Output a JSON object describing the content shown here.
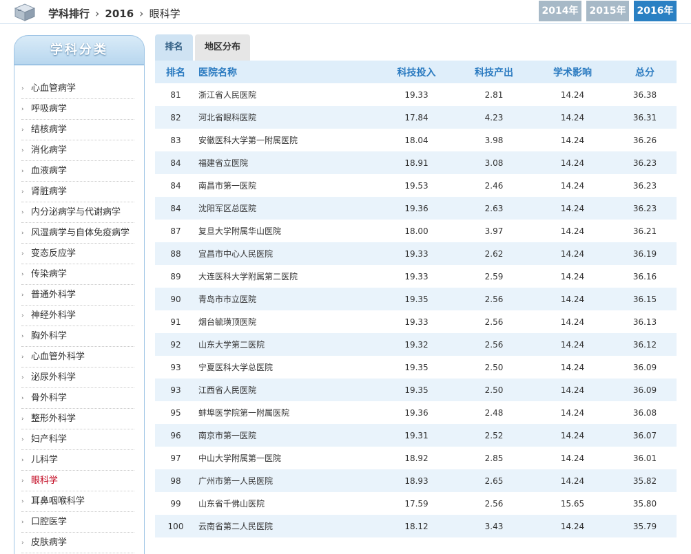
{
  "breadcrumb": {
    "root": "学科排行",
    "year": "2016",
    "current": "眼科学"
  },
  "years": [
    "2014年",
    "2015年",
    "2016年"
  ],
  "active_year_index": 2,
  "sidebar": {
    "title": "学科分类",
    "items": [
      "心血管病学",
      "呼吸病学",
      "结核病学",
      "消化病学",
      "血液病学",
      "肾脏病学",
      "内分泌病学与代谢病学",
      "风湿病学与自体免疫病学",
      "变态反应学",
      "传染病学",
      "普通外科学",
      "神经外科学",
      "胸外科学",
      "心血管外科学",
      "泌尿外科学",
      "骨外科学",
      "整形外科学",
      "妇产科学",
      "儿科学",
      "眼科学",
      "耳鼻咽喉科学",
      "口腔医学",
      "皮肤病学"
    ],
    "active_index": 19
  },
  "tabs": [
    "排名",
    "地区分布"
  ],
  "table": {
    "headers": {
      "rank": "排名",
      "name": "医院名称",
      "invest": "科技投入",
      "output": "科技产出",
      "impact": "学术影响",
      "total": "总分"
    },
    "rows": [
      {
        "rank": "81",
        "name": "浙江省人民医院",
        "invest": "19.33",
        "output": "2.81",
        "impact": "14.24",
        "total": "36.38"
      },
      {
        "rank": "82",
        "name": "河北省眼科医院",
        "invest": "17.84",
        "output": "4.23",
        "impact": "14.24",
        "total": "36.31"
      },
      {
        "rank": "83",
        "name": "安徽医科大学第一附属医院",
        "invest": "18.04",
        "output": "3.98",
        "impact": "14.24",
        "total": "36.26"
      },
      {
        "rank": "84",
        "name": "福建省立医院",
        "invest": "18.91",
        "output": "3.08",
        "impact": "14.24",
        "total": "36.23"
      },
      {
        "rank": "84",
        "name": "南昌市第一医院",
        "invest": "19.53",
        "output": "2.46",
        "impact": "14.24",
        "total": "36.23"
      },
      {
        "rank": "84",
        "name": "沈阳军区总医院",
        "invest": "19.36",
        "output": "2.63",
        "impact": "14.24",
        "total": "36.23"
      },
      {
        "rank": "87",
        "name": "复旦大学附属华山医院",
        "invest": "18.00",
        "output": "3.97",
        "impact": "14.24",
        "total": "36.21"
      },
      {
        "rank": "88",
        "name": "宜昌市中心人民医院",
        "invest": "19.33",
        "output": "2.62",
        "impact": "14.24",
        "total": "36.19"
      },
      {
        "rank": "89",
        "name": "大连医科大学附属第二医院",
        "invest": "19.33",
        "output": "2.59",
        "impact": "14.24",
        "total": "36.16"
      },
      {
        "rank": "90",
        "name": "青岛市市立医院",
        "invest": "19.35",
        "output": "2.56",
        "impact": "14.24",
        "total": "36.15"
      },
      {
        "rank": "91",
        "name": "烟台毓璜顶医院",
        "invest": "19.33",
        "output": "2.56",
        "impact": "14.24",
        "total": "36.13"
      },
      {
        "rank": "92",
        "name": "山东大学第二医院",
        "invest": "19.32",
        "output": "2.56",
        "impact": "14.24",
        "total": "36.12"
      },
      {
        "rank": "93",
        "name": "宁夏医科大学总医院",
        "invest": "19.35",
        "output": "2.50",
        "impact": "14.24",
        "total": "36.09"
      },
      {
        "rank": "93",
        "name": "江西省人民医院",
        "invest": "19.35",
        "output": "2.50",
        "impact": "14.24",
        "total": "36.09"
      },
      {
        "rank": "95",
        "name": "蚌埠医学院第一附属医院",
        "invest": "19.36",
        "output": "2.48",
        "impact": "14.24",
        "total": "36.08"
      },
      {
        "rank": "96",
        "name": "南京市第一医院",
        "invest": "19.31",
        "output": "2.52",
        "impact": "14.24",
        "total": "36.07"
      },
      {
        "rank": "97",
        "name": "中山大学附属第一医院",
        "invest": "18.92",
        "output": "2.85",
        "impact": "14.24",
        "total": "36.01"
      },
      {
        "rank": "98",
        "name": "广州市第一人民医院",
        "invest": "18.93",
        "output": "2.65",
        "impact": "14.24",
        "total": "35.82"
      },
      {
        "rank": "99",
        "name": "山东省千佛山医院",
        "invest": "17.59",
        "output": "2.56",
        "impact": "15.65",
        "total": "35.80"
      },
      {
        "rank": "100",
        "name": "云南省第二人民医院",
        "invest": "18.12",
        "output": "3.43",
        "impact": "14.24",
        "total": "35.79"
      }
    ]
  }
}
